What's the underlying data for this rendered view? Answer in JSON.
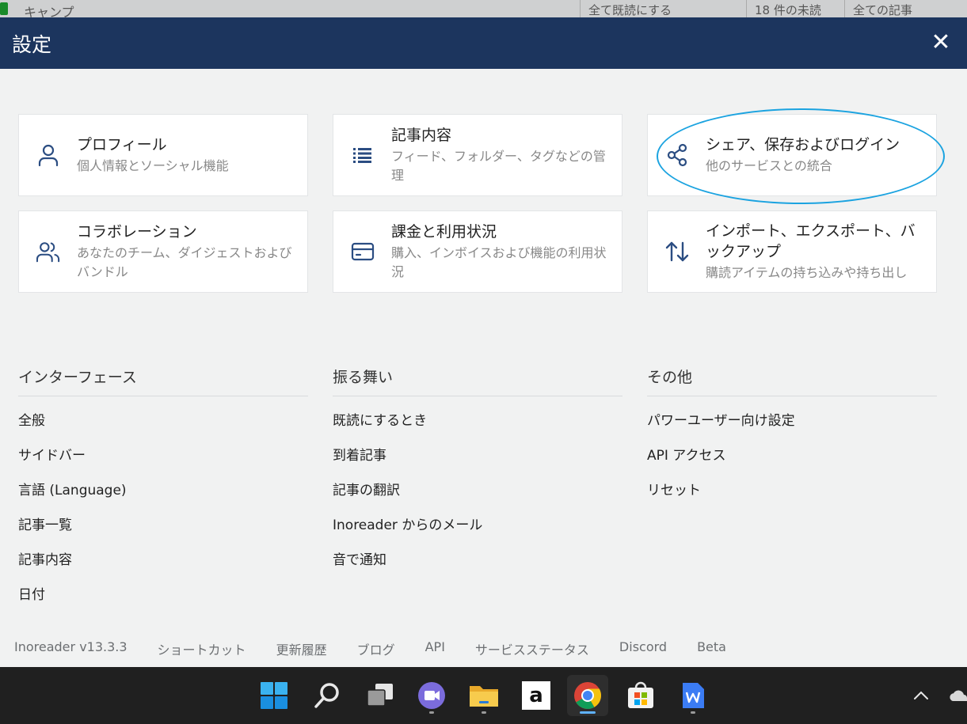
{
  "background_app": {
    "title": "キャンプ",
    "buttons": [
      "全て既読にする",
      "18 件の未読",
      "全ての記事"
    ]
  },
  "modal": {
    "title": "設定",
    "close_glyph": "✕"
  },
  "cards": [
    {
      "title": "プロフィール",
      "desc": "個人情報とソーシャル機能",
      "icon": "user-icon"
    },
    {
      "title": "記事内容",
      "desc": "フィード、フォルダー、タグなどの管理",
      "icon": "list-icon"
    },
    {
      "title": "シェア、保存およびログイン",
      "desc": "他のサービスとの統合",
      "icon": "share-icon"
    },
    {
      "title": "コラボレーション",
      "desc": "あなたのチーム、ダイジェストおよびバンドル",
      "icon": "users-icon"
    },
    {
      "title": "課金と利用状況",
      "desc": "購入、インボイスおよび機能の利用状況",
      "icon": "credit-card-icon"
    },
    {
      "title": "インポート、エクスポート、バックアップ",
      "desc": "購読アイテムの持ち込みや持ち出し",
      "icon": "import-export-icon"
    }
  ],
  "sections": [
    {
      "heading": "インターフェース",
      "links": [
        "全般",
        "サイドバー",
        "言語 (Language)",
        "記事一覧",
        "記事内容",
        "日付"
      ]
    },
    {
      "heading": "振る舞い",
      "links": [
        "既読にするとき",
        "到着記事",
        "記事の翻訳",
        "Inoreader からのメール",
        "音で通知"
      ]
    },
    {
      "heading": "その他",
      "links": [
        "パワーユーザー向け設定",
        "API アクセス",
        "リセット"
      ]
    }
  ],
  "footer": {
    "version": "Inoreader v13.3.3",
    "links": [
      "ショートカット",
      "更新履歴",
      "ブログ",
      "API",
      "サービスステータス",
      "Discord",
      "Beta"
    ]
  },
  "taskbar": {
    "apps": [
      "windows-start",
      "search",
      "task-view",
      "teams-chat",
      "file-explorer",
      "amazon",
      "chrome",
      "microsoft-store",
      "wps-writer"
    ],
    "active_app": "chrome",
    "amazon_glyph": "a"
  },
  "colors": {
    "header_bg": "#1c355e",
    "icon_blue": "#2b4d82",
    "highlight": "#1ba3e0",
    "taskbar_bg": "#202020"
  }
}
